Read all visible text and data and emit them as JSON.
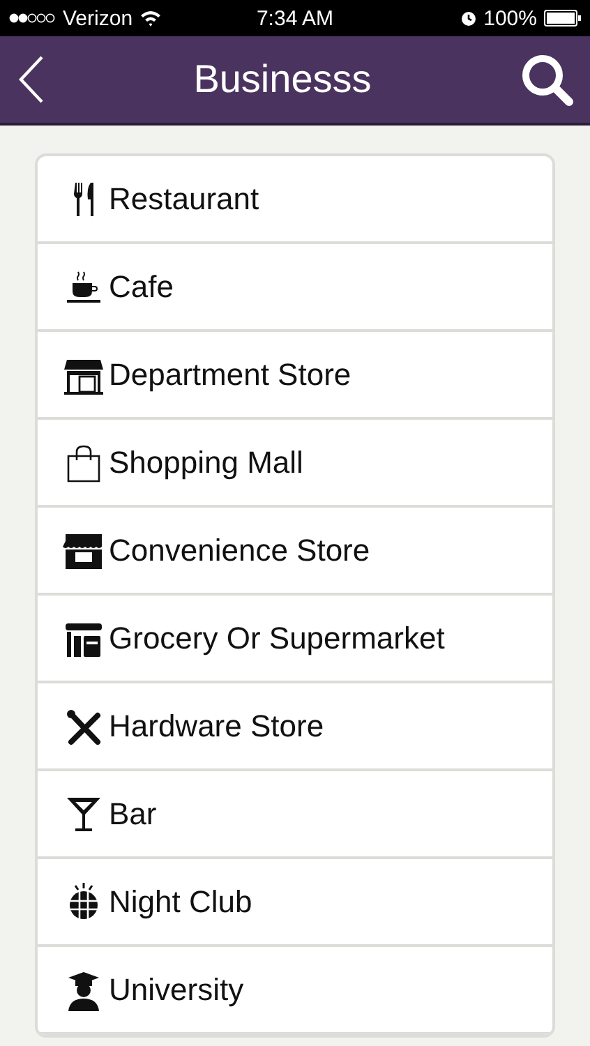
{
  "status_bar": {
    "carrier": "Verizon",
    "time": "7:34 AM",
    "battery": "100%"
  },
  "nav_bar": {
    "title": "Businesss"
  },
  "categories": [
    {
      "label": "Restaurant",
      "kind": "restaurant"
    },
    {
      "label": "Cafe",
      "kind": "cafe"
    },
    {
      "label": "Department Store",
      "kind": "department"
    },
    {
      "label": "Shopping Mall",
      "kind": "mall"
    },
    {
      "label": "Convenience Store",
      "kind": "convenience"
    },
    {
      "label": "Grocery Or Supermarket",
      "kind": "grocery"
    },
    {
      "label": "Hardware Store",
      "kind": "hardware"
    },
    {
      "label": "Bar",
      "kind": "bar"
    },
    {
      "label": "Night Club",
      "kind": "club"
    },
    {
      "label": "University",
      "kind": "university"
    }
  ]
}
